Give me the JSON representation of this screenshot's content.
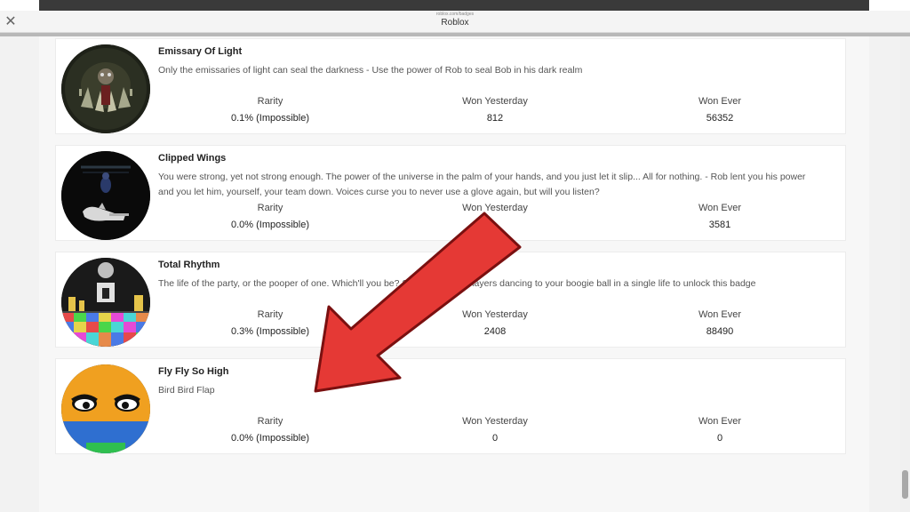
{
  "window": {
    "url": "roblox.com/badges",
    "title": "Roblox",
    "close_glyph": "✕"
  },
  "labels": {
    "rarity": "Rarity",
    "won_yesterday": "Won Yesterday",
    "won_ever": "Won Ever"
  },
  "badges": [
    {
      "title": "Emissary Of Light",
      "description": "Only the emissaries of light can seal the darkness - Use the power of Rob to seal Bob in his dark realm",
      "rarity": "0.1% (Impossible)",
      "won_yesterday": "812",
      "won_ever": "56352",
      "icon": "emissary-badge-image"
    },
    {
      "title": "Clipped Wings",
      "description": "You were strong, yet not strong enough. The power of the universe in the palm of your hands, and you just let it slip... All for nothing. - Rob lent you his power and you let him, yourself, your team down. Voices curse you to never use a glove again, but will you listen?",
      "rarity": "0.0% (Impossible)",
      "won_yesterday": "",
      "won_ever": "3581",
      "icon": "clipped-wings-badge-image"
    },
    {
      "title": "Total Rhythm",
      "description": "The life of the party, or the pooper of one. Which'll you be? Slap 10 unique players dancing to your boogie ball in a single life to unlock this badge",
      "rarity": "0.3% (Impossible)",
      "won_yesterday": "2408",
      "won_ever": "88490",
      "icon": "total-rhythm-badge-image"
    },
    {
      "title": "Fly Fly So High",
      "description": "Bird Bird Flap",
      "rarity": "0.0% (Impossible)",
      "won_yesterday": "0",
      "won_ever": "0",
      "icon": "fly-fly-badge-image"
    }
  ],
  "colors": {
    "arrow": "#e53935",
    "arrow_outline": "#7a1010"
  },
  "overlay_icon": "red-arrow-pointer-icon"
}
